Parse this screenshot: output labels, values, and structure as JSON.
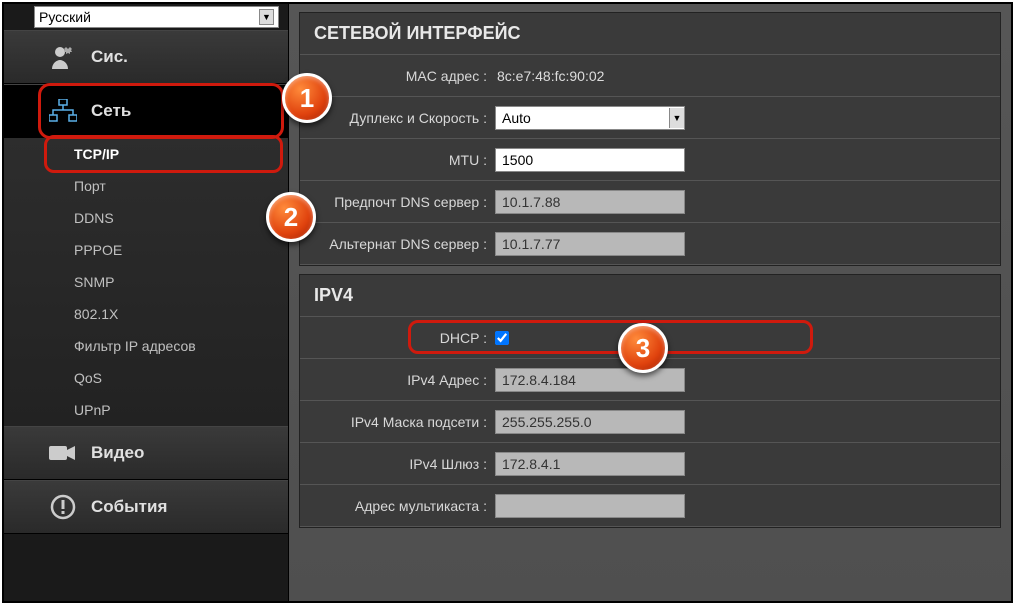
{
  "lang": "Русский",
  "nav": {
    "system": "Сис.",
    "network": "Сеть",
    "video": "Видео",
    "events": "События"
  },
  "sub": {
    "tcpip": "TCP/IP",
    "port": "Порт",
    "ddns": "DDNS",
    "pppoe": "PPPOE",
    "snmp": "SNMP",
    "dot1x": "802.1X",
    "ipfilter": "Фильтр IP адресов",
    "qos": "QoS",
    "upnp": "UPnP"
  },
  "panel1": {
    "title": "СЕТЕВОЙ ИНТЕРФЕЙС",
    "mac_label": "MAC адрес :",
    "mac": "8c:e7:48:fc:90:02",
    "duplex_label": "Дуплекс и Скорость :",
    "duplex": "Auto",
    "mtu_label": "MTU :",
    "mtu": "1500",
    "dns1_label": "Предпочт DNS сервер :",
    "dns1": "10.1.7.88",
    "dns2_label": "Альтернат DNS сервер :",
    "dns2": "10.1.7.77"
  },
  "panel2": {
    "title": "IPV4",
    "dhcp_label": "DHCP :",
    "ip_label": "IPv4 Адрес :",
    "ip": "172.8.4.184",
    "mask_label": "IPv4 Маска подсети :",
    "mask": "255.255.255.0",
    "gw_label": "IPv4 Шлюз :",
    "gw": "172.8.4.1",
    "mcast_label": "Адрес мультикаста :",
    "mcast": ""
  },
  "callouts": {
    "c1": "1",
    "c2": "2",
    "c3": "3"
  }
}
